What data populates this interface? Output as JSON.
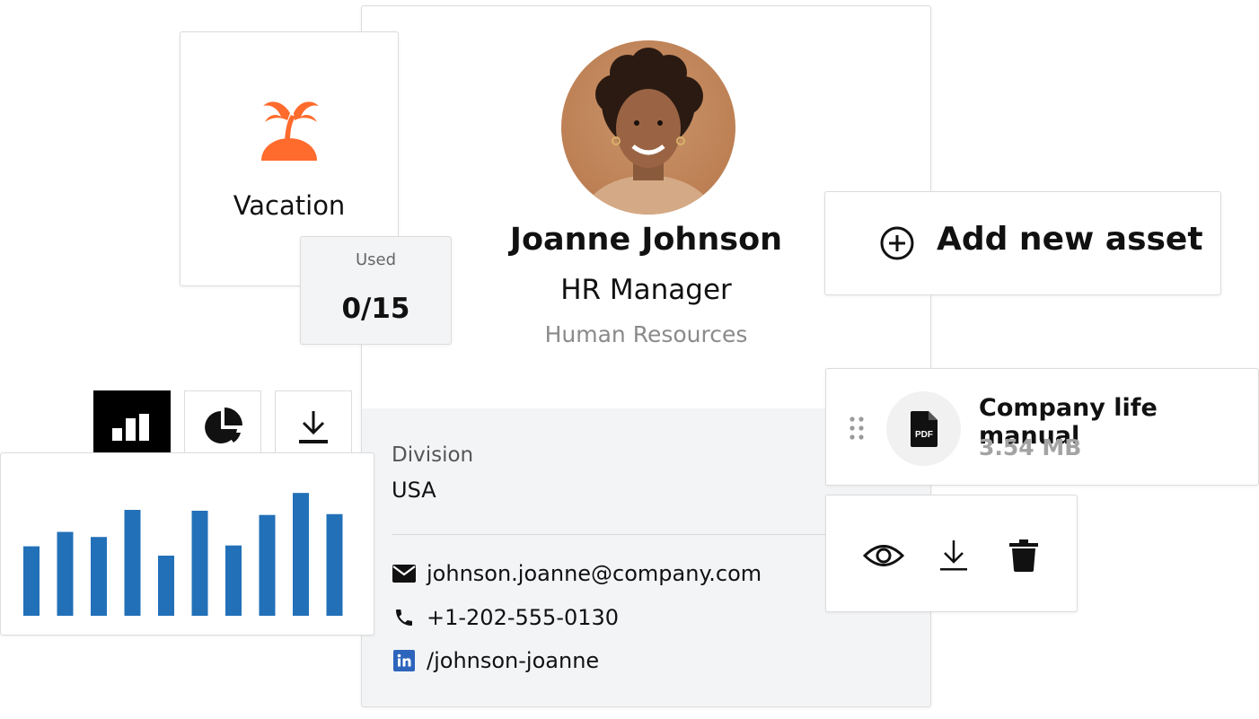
{
  "vacation": {
    "label": "Vacation",
    "used_label": "Used",
    "used_value": "0/15",
    "icon": "palm-tree-icon",
    "icon_color": "#ff6b2c"
  },
  "profile": {
    "name": "Joanne Johnson",
    "role": "HR Manager",
    "department": "Human Resources",
    "division_label": "Division",
    "division_value": "USA",
    "email": "johnson.joanne@company.com",
    "phone": "+1-202-555-0130",
    "linkedin": "/johnson-joanne",
    "linkedin_color": "#2d64bc"
  },
  "chart_toolbar": {
    "buttons": [
      "bar-chart-icon",
      "pie-chart-icon",
      "download-icon"
    ],
    "active": "bar-chart-icon"
  },
  "chart_data": {
    "type": "bar",
    "values": [
      82,
      99,
      93,
      125,
      71,
      124,
      83,
      119,
      145,
      120
    ],
    "ylim": [
      0,
      160
    ],
    "color": "#2270b8"
  },
  "assets": {
    "add_label": "Add new asset",
    "file_name": "Company life manual",
    "file_size": "3.54 MB",
    "file_type": "PDF",
    "actions": [
      "eye-icon",
      "download-icon",
      "trash-icon"
    ]
  }
}
